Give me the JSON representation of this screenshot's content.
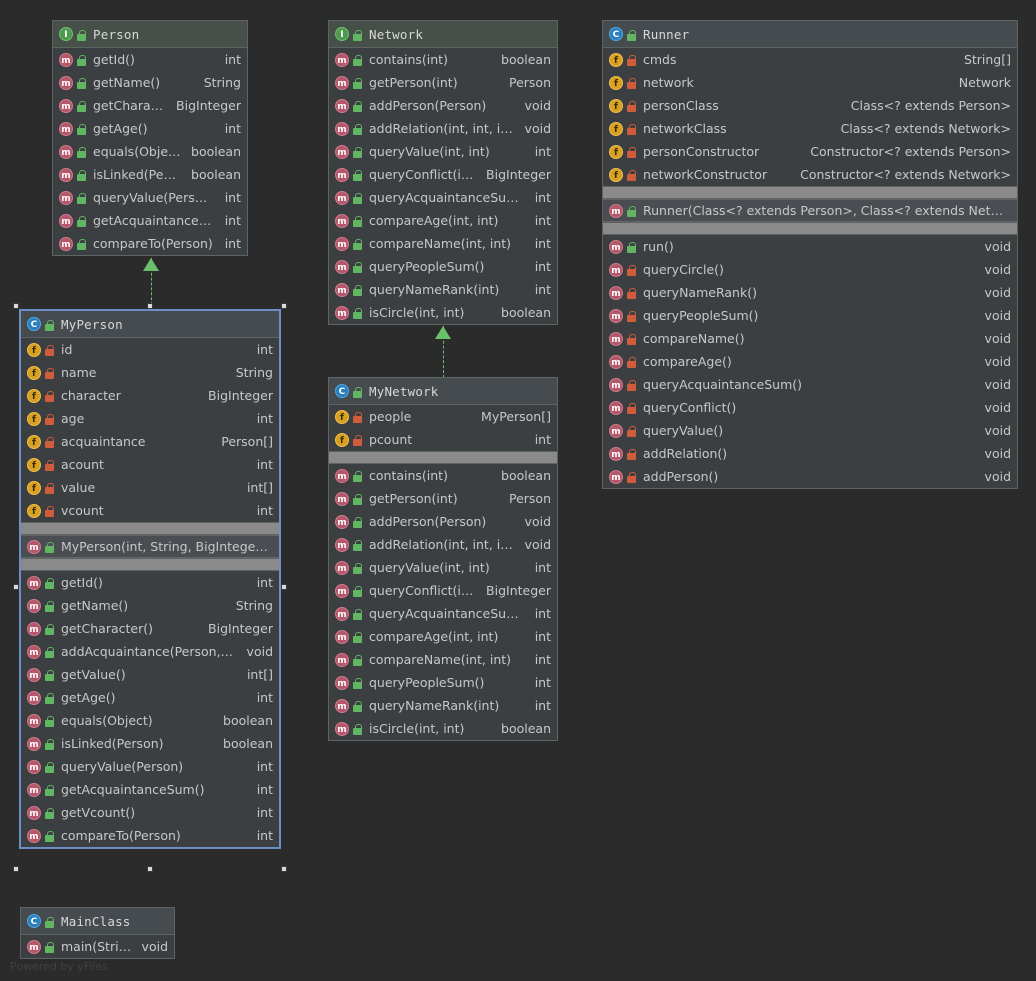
{
  "watermark": "Powered by yFiles",
  "nodes": {
    "person": {
      "name": "Person",
      "kind": "interface",
      "icon": "interface-icon",
      "members": [
        {
          "sig": "getId()",
          "type": "int",
          "icon": "method-icon",
          "vis": "public"
        },
        {
          "sig": "getName()",
          "type": "String",
          "icon": "method-icon",
          "vis": "public"
        },
        {
          "sig": "getCharacter()",
          "type": "BigInteger",
          "icon": "method-icon",
          "vis": "public"
        },
        {
          "sig": "getAge()",
          "type": "int",
          "icon": "method-icon",
          "vis": "public"
        },
        {
          "sig": "equals(Object)",
          "type": "boolean",
          "icon": "method-icon",
          "vis": "public"
        },
        {
          "sig": "isLinked(Person)",
          "type": "boolean",
          "icon": "method-icon",
          "vis": "public"
        },
        {
          "sig": "queryValue(Person)",
          "type": "int",
          "icon": "method-icon",
          "vis": "public"
        },
        {
          "sig": "getAcquaintanceSum()",
          "type": "int",
          "icon": "method-icon",
          "vis": "public"
        },
        {
          "sig": "compareTo(Person)",
          "type": "int",
          "icon": "method-icon",
          "vis": "public"
        }
      ]
    },
    "myperson": {
      "name": "MyPerson",
      "kind": "class",
      "icon": "class-icon",
      "selected": true,
      "fields": [
        {
          "sig": "id",
          "type": "int",
          "icon": "field-icon",
          "vis": "private"
        },
        {
          "sig": "name",
          "type": "String",
          "icon": "field-icon",
          "vis": "private"
        },
        {
          "sig": "character",
          "type": "BigInteger",
          "icon": "field-icon",
          "vis": "private"
        },
        {
          "sig": "age",
          "type": "int",
          "icon": "field-icon",
          "vis": "private"
        },
        {
          "sig": "acquaintance",
          "type": "Person[]",
          "icon": "field-icon",
          "vis": "private"
        },
        {
          "sig": "acount",
          "type": "int",
          "icon": "field-icon",
          "vis": "private"
        },
        {
          "sig": "value",
          "type": "int[]",
          "icon": "field-icon",
          "vis": "private"
        },
        {
          "sig": "vcount",
          "type": "int",
          "icon": "field-icon",
          "vis": "private"
        }
      ],
      "constructors": [
        {
          "sig": "MyPerson(int, String, BigInteger, int)",
          "type": "",
          "icon": "method-icon",
          "vis": "public"
        }
      ],
      "methods": [
        {
          "sig": "getId()",
          "type": "int",
          "icon": "method-icon",
          "vis": "public"
        },
        {
          "sig": "getName()",
          "type": "String",
          "icon": "method-icon",
          "vis": "public"
        },
        {
          "sig": "getCharacter()",
          "type": "BigInteger",
          "icon": "method-icon",
          "vis": "public"
        },
        {
          "sig": "addAcquaintance(Person, int)",
          "type": "void",
          "icon": "method-icon",
          "vis": "public"
        },
        {
          "sig": "getValue()",
          "type": "int[]",
          "icon": "method-icon",
          "vis": "public"
        },
        {
          "sig": "getAge()",
          "type": "int",
          "icon": "method-icon",
          "vis": "public"
        },
        {
          "sig": "equals(Object)",
          "type": "boolean",
          "icon": "method-icon",
          "vis": "public"
        },
        {
          "sig": "isLinked(Person)",
          "type": "boolean",
          "icon": "method-icon",
          "vis": "public"
        },
        {
          "sig": "queryValue(Person)",
          "type": "int",
          "icon": "method-icon",
          "vis": "public"
        },
        {
          "sig": "getAcquaintanceSum()",
          "type": "int",
          "icon": "method-icon",
          "vis": "public"
        },
        {
          "sig": "getVcount()",
          "type": "int",
          "icon": "method-icon",
          "vis": "public"
        },
        {
          "sig": "compareTo(Person)",
          "type": "int",
          "icon": "method-icon",
          "vis": "public"
        }
      ]
    },
    "network": {
      "name": "Network",
      "kind": "interface",
      "icon": "interface-icon",
      "members": [
        {
          "sig": "contains(int)",
          "type": "boolean",
          "icon": "method-icon",
          "vis": "public"
        },
        {
          "sig": "getPerson(int)",
          "type": "Person",
          "icon": "method-icon",
          "vis": "public"
        },
        {
          "sig": "addPerson(Person)",
          "type": "void",
          "icon": "method-icon",
          "vis": "public"
        },
        {
          "sig": "addRelation(int, int, int)",
          "type": "void",
          "icon": "method-icon",
          "vis": "public"
        },
        {
          "sig": "queryValue(int, int)",
          "type": "int",
          "icon": "method-icon",
          "vis": "public"
        },
        {
          "sig": "queryConflict(int, int)",
          "type": "BigInteger",
          "icon": "method-icon",
          "vis": "public"
        },
        {
          "sig": "queryAcquaintanceSum(int)",
          "type": "int",
          "icon": "method-icon",
          "vis": "public"
        },
        {
          "sig": "compareAge(int, int)",
          "type": "int",
          "icon": "method-icon",
          "vis": "public"
        },
        {
          "sig": "compareName(int, int)",
          "type": "int",
          "icon": "method-icon",
          "vis": "public"
        },
        {
          "sig": "queryPeopleSum()",
          "type": "int",
          "icon": "method-icon",
          "vis": "public"
        },
        {
          "sig": "queryNameRank(int)",
          "type": "int",
          "icon": "method-icon",
          "vis": "public"
        },
        {
          "sig": "isCircle(int, int)",
          "type": "boolean",
          "icon": "method-icon",
          "vis": "public"
        }
      ]
    },
    "mynetwork": {
      "name": "MyNetwork",
      "kind": "class",
      "icon": "class-icon",
      "fields": [
        {
          "sig": "people",
          "type": "MyPerson[]",
          "icon": "field-icon",
          "vis": "private"
        },
        {
          "sig": "pcount",
          "type": "int",
          "icon": "field-icon",
          "vis": "private"
        }
      ],
      "methods": [
        {
          "sig": "contains(int)",
          "type": "boolean",
          "icon": "method-icon",
          "vis": "public"
        },
        {
          "sig": "getPerson(int)",
          "type": "Person",
          "icon": "method-icon",
          "vis": "public"
        },
        {
          "sig": "addPerson(Person)",
          "type": "void",
          "icon": "method-icon",
          "vis": "public"
        },
        {
          "sig": "addRelation(int, int, int)",
          "type": "void",
          "icon": "method-icon",
          "vis": "public"
        },
        {
          "sig": "queryValue(int, int)",
          "type": "int",
          "icon": "method-icon",
          "vis": "public"
        },
        {
          "sig": "queryConflict(int, int)",
          "type": "BigInteger",
          "icon": "method-icon",
          "vis": "public"
        },
        {
          "sig": "queryAcquaintanceSum(int)",
          "type": "int",
          "icon": "method-icon",
          "vis": "public"
        },
        {
          "sig": "compareAge(int, int)",
          "type": "int",
          "icon": "method-icon",
          "vis": "public"
        },
        {
          "sig": "compareName(int, int)",
          "type": "int",
          "icon": "method-icon",
          "vis": "public"
        },
        {
          "sig": "queryPeopleSum()",
          "type": "int",
          "icon": "method-icon",
          "vis": "public"
        },
        {
          "sig": "queryNameRank(int)",
          "type": "int",
          "icon": "method-icon",
          "vis": "public"
        },
        {
          "sig": "isCircle(int, int)",
          "type": "boolean",
          "icon": "method-icon",
          "vis": "public"
        }
      ]
    },
    "runner": {
      "name": "Runner",
      "kind": "class",
      "icon": "class-icon",
      "fields": [
        {
          "sig": "cmds",
          "type": "String[]",
          "icon": "field-icon",
          "vis": "private"
        },
        {
          "sig": "network",
          "type": "Network",
          "icon": "field-icon",
          "vis": "private"
        },
        {
          "sig": "personClass",
          "type": "Class<? extends Person>",
          "icon": "field-icon",
          "vis": "private"
        },
        {
          "sig": "networkClass",
          "type": "Class<? extends Network>",
          "icon": "field-icon",
          "vis": "private"
        },
        {
          "sig": "personConstructor",
          "type": "Constructor<? extends Person>",
          "icon": "field-icon",
          "vis": "private"
        },
        {
          "sig": "networkConstructor",
          "type": "Constructor<? extends Network>",
          "icon": "field-icon",
          "vis": "private"
        }
      ],
      "constructors": [
        {
          "sig": "Runner(Class<? extends Person>, Class<? extends Network>)",
          "type": "",
          "icon": "method-icon",
          "vis": "public"
        }
      ],
      "methods": [
        {
          "sig": "run()",
          "type": "void",
          "icon": "method-icon",
          "vis": "public"
        },
        {
          "sig": "queryCircle()",
          "type": "void",
          "icon": "method-icon",
          "vis": "private"
        },
        {
          "sig": "queryNameRank()",
          "type": "void",
          "icon": "method-icon",
          "vis": "private"
        },
        {
          "sig": "queryPeopleSum()",
          "type": "void",
          "icon": "method-icon",
          "vis": "private"
        },
        {
          "sig": "compareName()",
          "type": "void",
          "icon": "method-icon",
          "vis": "private"
        },
        {
          "sig": "compareAge()",
          "type": "void",
          "icon": "method-icon",
          "vis": "private"
        },
        {
          "sig": "queryAcquaintanceSum()",
          "type": "void",
          "icon": "method-icon",
          "vis": "private"
        },
        {
          "sig": "queryConflict()",
          "type": "void",
          "icon": "method-icon",
          "vis": "private"
        },
        {
          "sig": "queryValue()",
          "type": "void",
          "icon": "method-icon",
          "vis": "private"
        },
        {
          "sig": "addRelation()",
          "type": "void",
          "icon": "method-icon",
          "vis": "private"
        },
        {
          "sig": "addPerson()",
          "type": "void",
          "icon": "method-icon",
          "vis": "private"
        }
      ]
    },
    "mainclass": {
      "name": "MainClass",
      "kind": "class",
      "icon": "class-icon",
      "methods": [
        {
          "sig": "main(String[])",
          "type": "void",
          "icon": "method-icon",
          "vis": "public"
        }
      ]
    }
  },
  "edges": [
    {
      "from": "MyPerson",
      "to": "Person",
      "type": "realization"
    },
    {
      "from": "MyNetwork",
      "to": "Network",
      "type": "realization"
    }
  ],
  "colors": {
    "background": "#2b2b2b",
    "node_body": "#3c3f41",
    "node_border": "#5e6364",
    "interface_header": "#465048",
    "class_header": "#464b50",
    "separator_band": "#8a8a8a",
    "selection": "#6c8fc7",
    "edge": "#6abf6a",
    "interface_icon": "#4f9a4f",
    "class_icon": "#2b7fbf",
    "method_icon": "#b5576b",
    "field_icon": "#d8a022",
    "public_lock": "#62b562",
    "private_lock": "#cf5c3a"
  }
}
